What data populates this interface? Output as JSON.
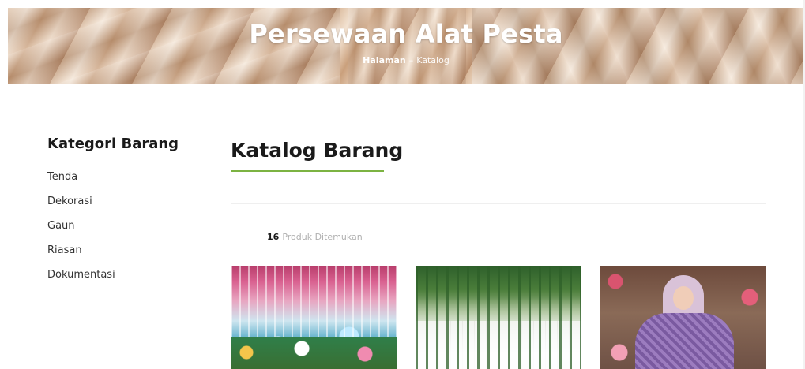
{
  "hero": {
    "title": "Persewaan Alat Pesta",
    "breadcrumb": {
      "home": "Halaman",
      "separator": "–",
      "current": "Katalog"
    }
  },
  "sidebar": {
    "title": "Kategori Barang",
    "items": [
      {
        "label": "Tenda"
      },
      {
        "label": "Dekorasi"
      },
      {
        "label": "Gaun"
      },
      {
        "label": "Riasan"
      },
      {
        "label": "Dokumentasi"
      }
    ]
  },
  "main": {
    "title": "Katalog Barang",
    "accent_color": "#7cb342",
    "result": {
      "count": "16",
      "label": "Produk Ditemukan"
    },
    "products": [
      {
        "image": "decoration-photo"
      },
      {
        "image": "greenery-backdrop-photo"
      },
      {
        "image": "hijab-gown-photo"
      }
    ]
  }
}
